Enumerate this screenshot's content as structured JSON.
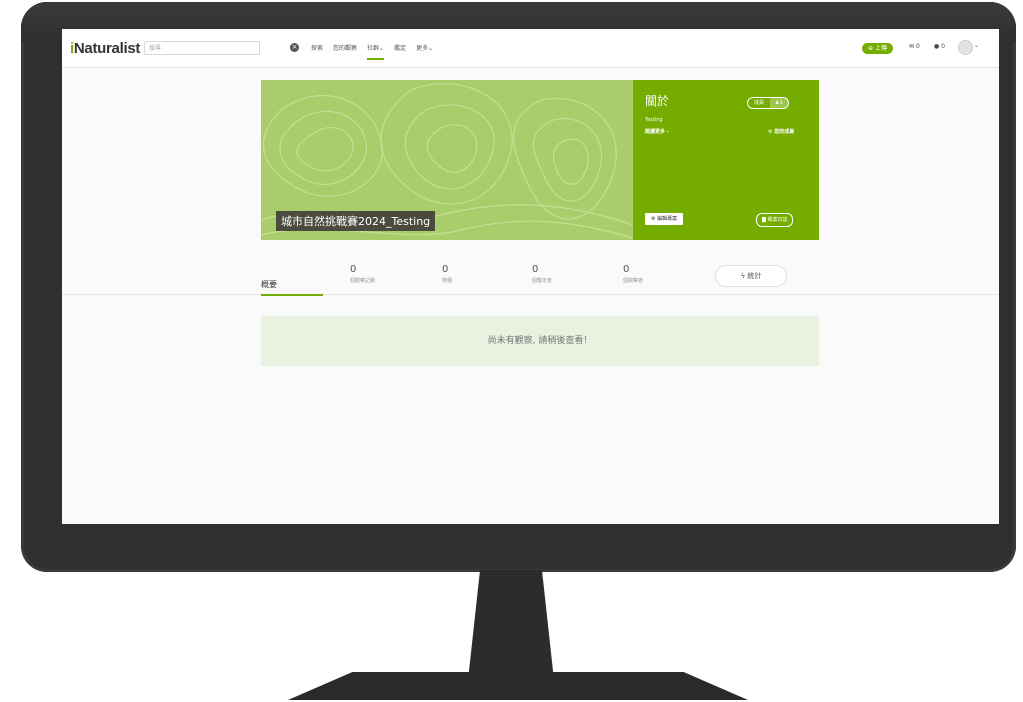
{
  "header": {
    "logo": "iNaturalist",
    "logo_i": "i",
    "logo_rest": "Naturalist",
    "search_placeholder": "搜尋",
    "nav": [
      "探索",
      "您的觀察",
      "社群",
      "鑑定",
      "更多"
    ],
    "upload_label": "上傳",
    "messages_count": "0",
    "notifications_count": "0"
  },
  "project": {
    "title": "城市自然挑戰賽2024_Testing",
    "about_title": "關於",
    "members_label": "成員",
    "members_count": "1",
    "description": "Testing",
    "read_more": "閱讀更多",
    "join_label": "您的成員",
    "edit_label": "編輯專案",
    "journal_label": "專案日誌"
  },
  "tabs": {
    "overview": "概要",
    "stats": [
      {
        "num": "0",
        "label": "個觀察記錄"
      },
      {
        "num": "0",
        "label": "物種"
      },
      {
        "num": "0",
        "label": "個鑑定者"
      },
      {
        "num": "0",
        "label": "個觀察者"
      }
    ],
    "stats_button": "統計"
  },
  "empty_message": "尚未有觀察, 請稍後查看！",
  "colors": {
    "accent": "#74ac00",
    "banner": "#a9cd6b",
    "empty_bg": "#e9f1e0",
    "bezel": "#2f2f2f"
  },
  "icons": [
    "clear-search-icon",
    "plus-circle-icon",
    "envelope-icon",
    "chat-icon",
    "avatar-icon",
    "user-icon",
    "gear-icon",
    "book-icon",
    "bolt-icon",
    "chevron-down-icon"
  ]
}
